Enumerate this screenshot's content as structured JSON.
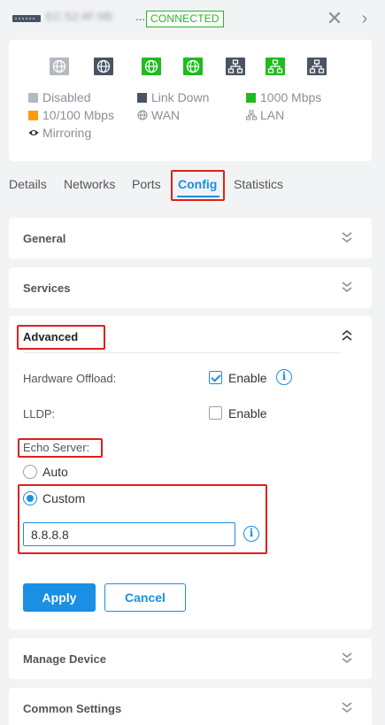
{
  "header": {
    "device_name": "EC:52:4F:9B:",
    "name_ellipsis": "...",
    "status": "CONNECTED",
    "close_glyph": "✕",
    "next_glyph": "›"
  },
  "ports": [
    {
      "state": "disabled",
      "kind": "wan"
    },
    {
      "state": "link-down",
      "kind": "wan"
    },
    {
      "state": "1000",
      "kind": "wan"
    },
    {
      "state": "1000",
      "kind": "wan"
    },
    {
      "state": "link-down",
      "kind": "lan"
    },
    {
      "state": "1000",
      "kind": "lan"
    },
    {
      "state": "link-down",
      "kind": "lan"
    }
  ],
  "legend": {
    "disabled": "Disabled",
    "link_down": "Link Down",
    "speed_1000": "1000 Mbps",
    "speed_10_100": "10/100 Mbps",
    "wan": "WAN",
    "lan": "LAN",
    "mirroring": "Mirroring"
  },
  "colors": {
    "accent": "#1a8fe3",
    "connected": "#1fbb1f",
    "port_disabled": "#b4b8bf",
    "port_link_down": "#4a5363",
    "port_1000": "#1fbb1f",
    "port_10_100": "#ff9a0a",
    "highlight": "#e0201b"
  },
  "tabs": [
    {
      "label": "Details"
    },
    {
      "label": "Networks"
    },
    {
      "label": "Ports"
    },
    {
      "label": "Config",
      "active": true
    },
    {
      "label": "Statistics"
    }
  ],
  "sections": {
    "general": "General",
    "services": "Services",
    "advanced": "Advanced",
    "manage_device": "Manage Device",
    "common_settings": "Common Settings"
  },
  "advanced": {
    "hardware_offload_label": "Hardware Offload:",
    "hardware_offload_checked": true,
    "hardware_offload_option": "Enable",
    "lldp_label": "LLDP:",
    "lldp_checked": false,
    "lldp_option": "Enable",
    "echo_server_label": "Echo Server:",
    "radio_auto": "Auto",
    "radio_custom": "Custom",
    "selected": "Custom",
    "custom_value": "8.8.8.8",
    "info_glyph": "i"
  },
  "buttons": {
    "apply": "Apply",
    "cancel": "Cancel"
  }
}
